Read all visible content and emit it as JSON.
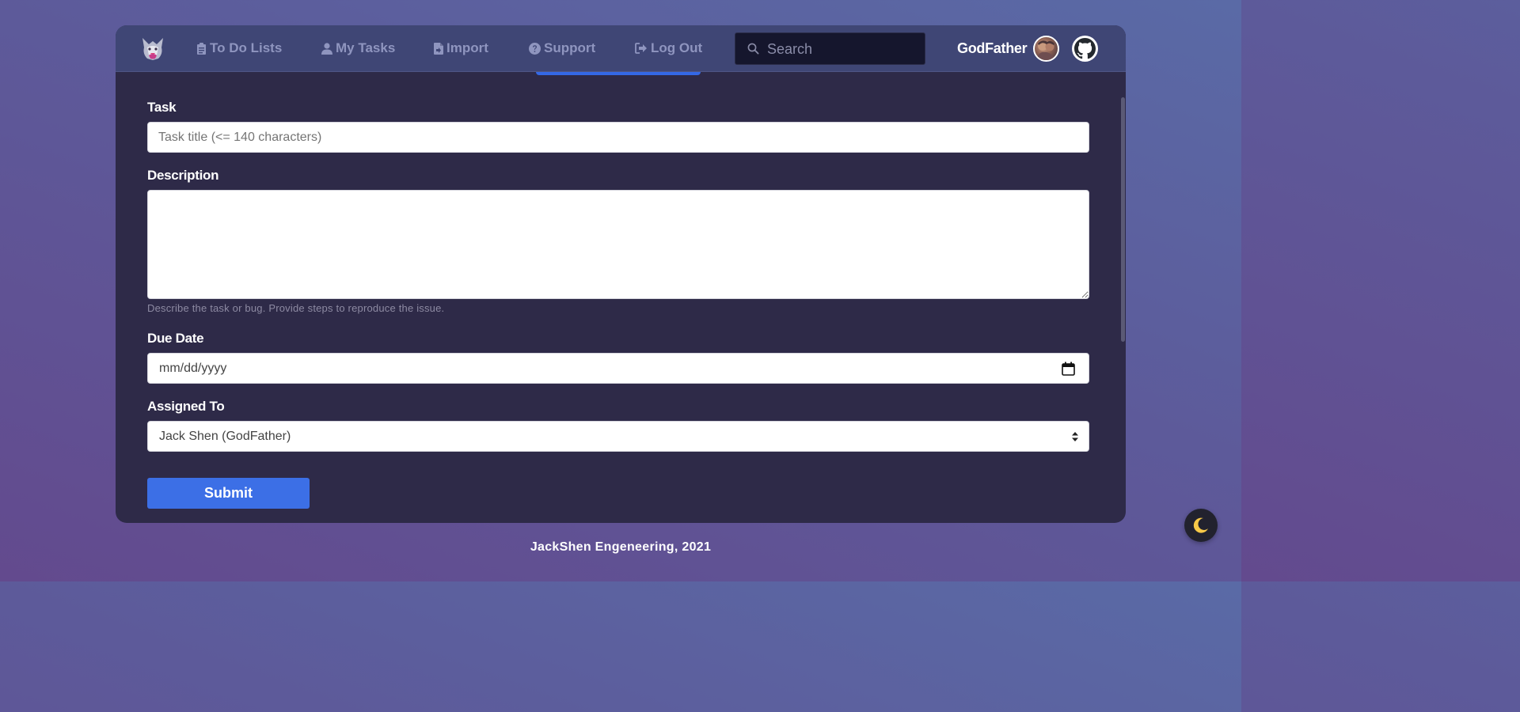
{
  "nav": {
    "items": [
      {
        "label": "To Do Lists",
        "icon": "clipboard-icon"
      },
      {
        "label": "My Tasks",
        "icon": "user-icon"
      },
      {
        "label": "Import",
        "icon": "file-import-icon"
      },
      {
        "label": "Support",
        "icon": "question-circle-icon"
      },
      {
        "label": "Log Out",
        "icon": "sign-out-icon"
      }
    ],
    "search_placeholder": "Search",
    "username": "GodFather"
  },
  "form": {
    "task_label": "Task",
    "task_placeholder": "Task title (<= 140 characters)",
    "description_label": "Description",
    "description_value": "",
    "description_help": "Describe the task or bug. Provide steps to reproduce the issue.",
    "due_date_label": "Due Date",
    "due_date_placeholder": "mm/dd/yyyy",
    "assigned_label": "Assigned To",
    "assigned_value": "Jack Shen (GodFather)",
    "submit_label": "Submit"
  },
  "footer": {
    "text": "JackShen Engeneering, 2021"
  },
  "colors": {
    "accent": "#3c6fe6",
    "navbar": "#3f4675",
    "card": "#2e2a48",
    "moon": "#f7c948"
  }
}
